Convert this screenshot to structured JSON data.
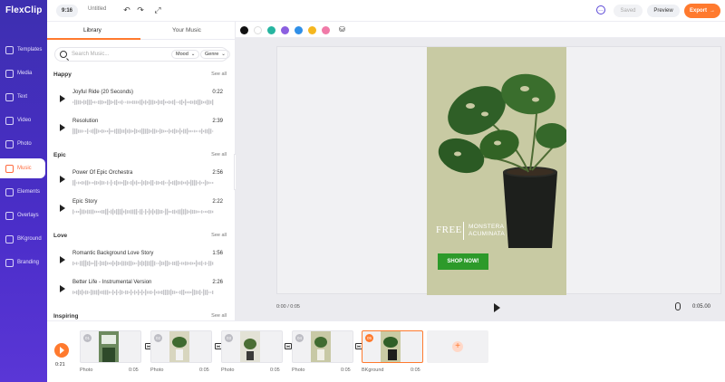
{
  "app": {
    "logo_text": "FlexClip"
  },
  "topbar": {
    "aspect": "9:16",
    "project_name": "Untitled",
    "saved_label": "Saved",
    "preview_label": "Preview",
    "export_label": "Export"
  },
  "sidebar": {
    "items": [
      {
        "label": "Templates",
        "icon": "templates-icon"
      },
      {
        "label": "Media",
        "icon": "media-icon"
      },
      {
        "label": "Text",
        "icon": "text-icon"
      },
      {
        "label": "Video",
        "icon": "video-icon"
      },
      {
        "label": "Photo",
        "icon": "photo-icon"
      },
      {
        "label": "Music",
        "icon": "music-icon",
        "active": true
      },
      {
        "label": "Elements",
        "icon": "elements-icon"
      },
      {
        "label": "Overlays",
        "icon": "overlays-icon"
      },
      {
        "label": "BKground",
        "icon": "background-icon"
      },
      {
        "label": "Branding",
        "icon": "branding-icon"
      }
    ]
  },
  "library": {
    "tabs": [
      "Library",
      "Your Music"
    ],
    "search_placeholder": "Search Music...",
    "mood_label": "Mood",
    "genre_label": "Genre",
    "see_all": "See all",
    "sections": [
      {
        "title": "Happy",
        "tracks": [
          {
            "name": "Joyful Ride (20 Seconds)",
            "duration": "0:22"
          },
          {
            "name": "Resolution",
            "duration": "2:39"
          }
        ]
      },
      {
        "title": "Epic",
        "tracks": [
          {
            "name": "Power Of Epic Orchestra",
            "duration": "2:56"
          },
          {
            "name": "Epic Story",
            "duration": "2:22"
          }
        ]
      },
      {
        "title": "Love",
        "tracks": [
          {
            "name": "Romantic Background Love Story",
            "duration": "1:56"
          },
          {
            "name": "Better Life - Instrumental Version",
            "duration": "2:26"
          }
        ]
      },
      {
        "title": "Inspiring",
        "tracks": []
      }
    ]
  },
  "colors": {
    "swatches": [
      "#111111",
      "#ffffff",
      "#26b5a0",
      "#8b5fe0",
      "#2f8fe8",
      "#f5b71f",
      "#f07aa8"
    ],
    "accent": "#ff7a2e",
    "brand": "#4b2ec9"
  },
  "canvas": {
    "free_text": "FREE",
    "product_line1": "MONSTERA",
    "product_line2": "ACUMINATA",
    "cta": "SHOP NOW!",
    "time_current": "0:00 / 0:05",
    "time_total": "0:05.00"
  },
  "timeline": {
    "current_time": "0:21",
    "clips": [
      {
        "num": "01",
        "label": "Photo",
        "duration": "0:05"
      },
      {
        "num": "02",
        "label": "Photo",
        "duration": "0:05"
      },
      {
        "num": "03",
        "label": "Photo",
        "duration": "0:05"
      },
      {
        "num": "04",
        "label": "Photo",
        "duration": "0:05"
      },
      {
        "num": "05",
        "label": "BKground",
        "duration": "0:05",
        "selected": true
      }
    ]
  }
}
